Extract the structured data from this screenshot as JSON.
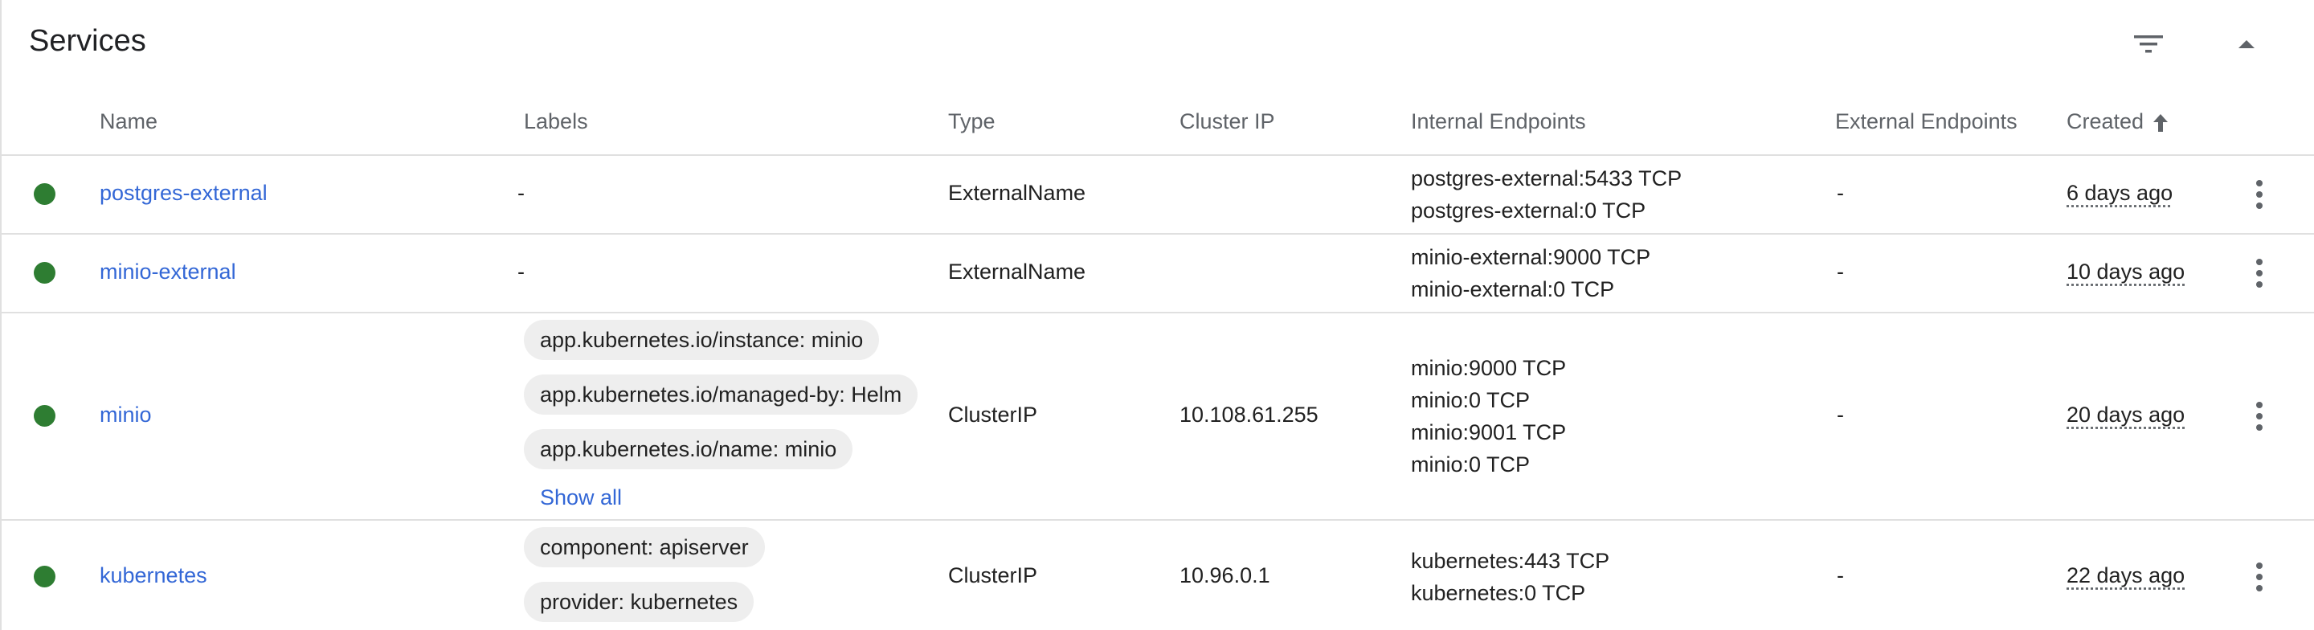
{
  "card": {
    "title": "Services"
  },
  "columns": {
    "name": "Name",
    "labels": "Labels",
    "type": "Type",
    "cluster_ip": "Cluster IP",
    "internal_endpoints": "Internal Endpoints",
    "external_endpoints": "External Endpoints",
    "created": "Created"
  },
  "icons": {
    "filter": "filter-icon",
    "collapse": "chevron-up-icon",
    "sort": "arrow-upward-icon",
    "status": "status-ok-icon",
    "menu": "more-vert-icon"
  },
  "colors": {
    "status_ok": "#2e7d32",
    "link": "#3367d6",
    "chip_bg": "#eeeeee"
  },
  "rows": [
    {
      "name": "postgres-external",
      "labels_text": "-",
      "type": "ExternalName",
      "cluster_ip": "",
      "endpoints": [
        "postgres-external:5433 TCP",
        "postgres-external:0 TCP"
      ],
      "external": "-",
      "created": "6 days ago"
    },
    {
      "name": "minio-external",
      "labels_text": "-",
      "type": "ExternalName",
      "cluster_ip": "",
      "endpoints": [
        "minio-external:9000 TCP",
        "minio-external:0 TCP"
      ],
      "external": "-",
      "created": "10 days ago"
    },
    {
      "name": "minio",
      "labels": [
        "app.kubernetes.io/instance: minio",
        "app.kubernetes.io/managed-by: Helm",
        "app.kubernetes.io/name: minio"
      ],
      "show_all": "Show all",
      "type": "ClusterIP",
      "cluster_ip": "10.108.61.255",
      "endpoints": [
        "minio:9000 TCP",
        "minio:0 TCP",
        "minio:9001 TCP",
        "minio:0 TCP"
      ],
      "external": "-",
      "created": "20 days ago"
    },
    {
      "name": "kubernetes",
      "labels": [
        "component: apiserver",
        "provider: kubernetes"
      ],
      "type": "ClusterIP",
      "cluster_ip": "10.96.0.1",
      "endpoints": [
        "kubernetes:443 TCP",
        "kubernetes:0 TCP"
      ],
      "external": "-",
      "created": "22 days ago"
    }
  ]
}
